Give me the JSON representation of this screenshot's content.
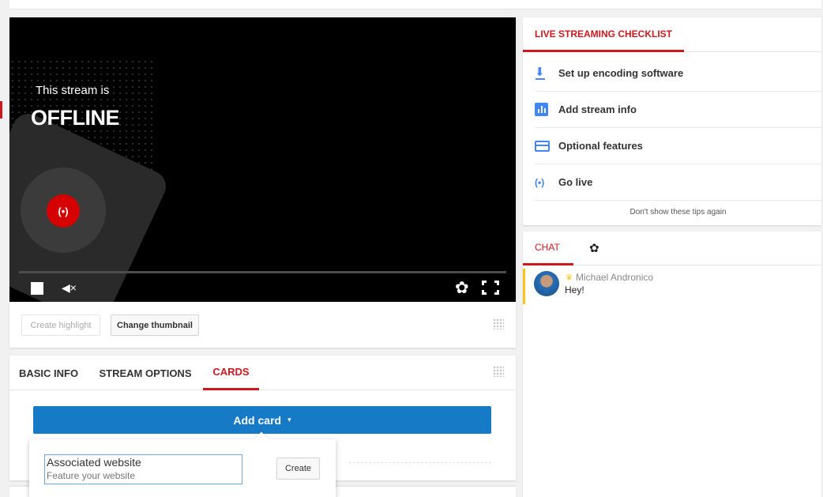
{
  "player": {
    "status_sub": "This stream is",
    "status_main": "OFFLINE",
    "live_glyph": "(•)",
    "mute_glyph": "◀×",
    "gear_glyph": "✿"
  },
  "actions": {
    "create_highlight": "Create highlight",
    "change_thumbnail": "Change thumbnail"
  },
  "tabs": [
    {
      "label": "BASIC INFO",
      "active": false
    },
    {
      "label": "STREAM OPTIONS",
      "active": false
    },
    {
      "label": "CARDS",
      "active": true
    }
  ],
  "cards": {
    "add_card_label": "Add card",
    "caret": "▾"
  },
  "dropdown": {
    "title": "Associated website",
    "subtitle": "Feature your website",
    "create_label": "Create"
  },
  "checklist": {
    "title": "LIVE STREAMING CHECKLIST",
    "items": [
      {
        "label": "Set up encoding software",
        "icon": "download-icon"
      },
      {
        "label": "Add stream info",
        "icon": "chart-icon"
      },
      {
        "label": "Optional features",
        "icon": "card-icon"
      },
      {
        "label": "Go live",
        "icon": "broadcast-icon"
      }
    ],
    "tips_link": "Don't show these tips again"
  },
  "chat": {
    "tab_label": "CHAT",
    "messages": [
      {
        "author": "Michael Andronico",
        "text": "Hey!"
      }
    ]
  },
  "colors": {
    "accent_red": "#cc181e",
    "button_blue": "#167ac6",
    "icon_blue": "#4285f4",
    "owner_gold": "#f5c518"
  }
}
